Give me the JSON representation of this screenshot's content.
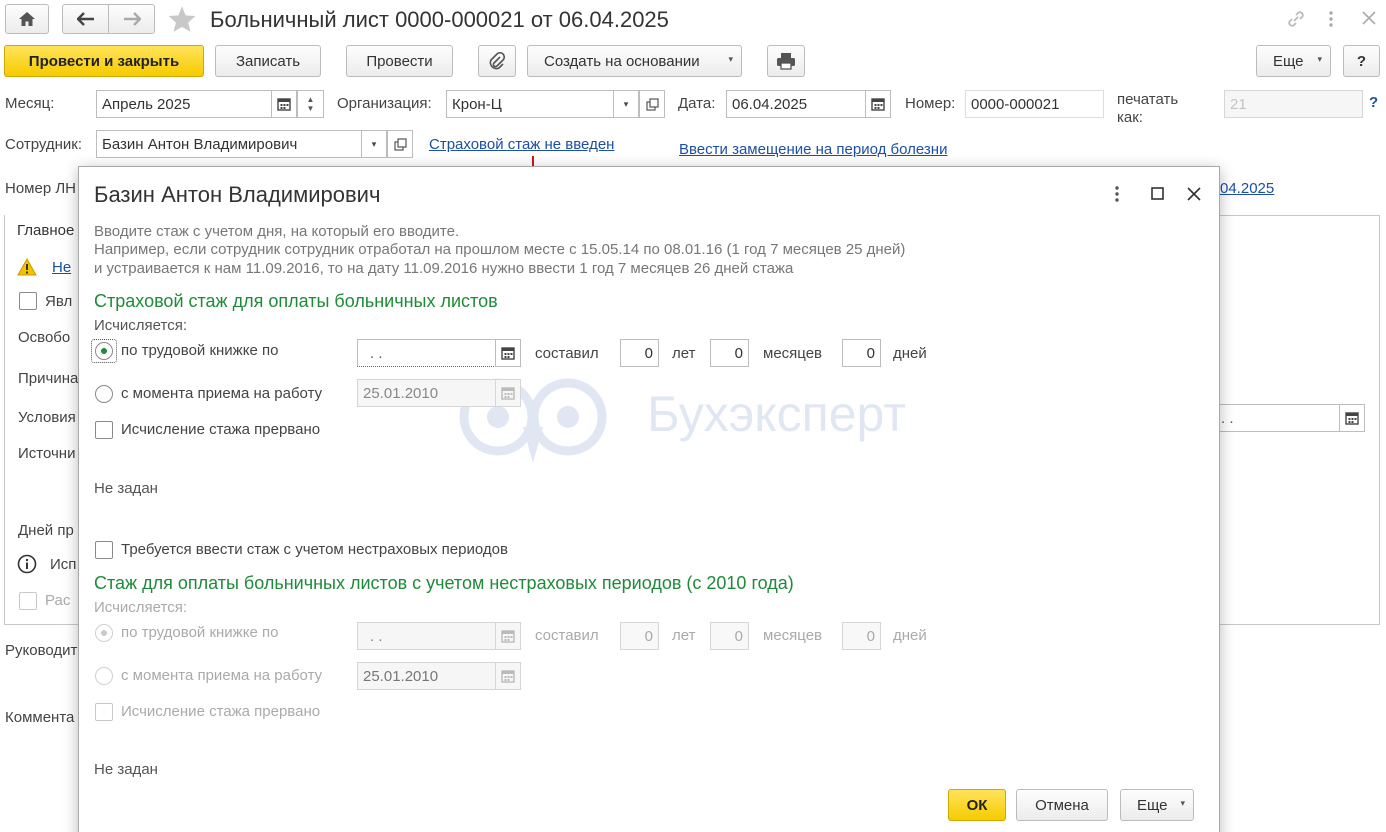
{
  "window": {
    "title": "Больничный лист 0000-000021 от 06.04.2025"
  },
  "toolbar": {
    "post_close": "Провести и закрыть",
    "save": "Записать",
    "post": "Провести",
    "create_based": "Создать на основании",
    "more": "Еще",
    "help": "?"
  },
  "form": {
    "month_label": "Месяц:",
    "month_value": "Апрель 2025",
    "org_label": "Организация:",
    "org_value": "Крон-Ц",
    "date_label": "Дата:",
    "date_value": "06.04.2025",
    "number_label": "Номер:",
    "number_value": "0000-000021",
    "print_as_label": "печатать как:",
    "print_as_placeholder": "21",
    "print_as_help": "?",
    "employee_label": "Сотрудник:",
    "employee_value": "Базин Антон Владимирович",
    "insurance_link": "Страховой стаж не введен",
    "replacement_link": "Ввести замещение на период болезни",
    "lnr_label": "Номер ЛН",
    "right_date_link": "04.2025",
    "tab_main": "Главное",
    "warn_link": "Не",
    "row_is": "Явл",
    "row_release": "Освобо",
    "row_reason": "Причина",
    "row_conditions": "Условия",
    "row_source": "Источни",
    "row_days": "Дней пр",
    "row_use": "Исп",
    "row_calc": "Рас",
    "right_date_field": ".   .",
    "head_label": "Руководит",
    "comment_label": "Коммента"
  },
  "dialog": {
    "title": "Базин Антон Владимирович",
    "hint_lines": [
      "Вводите стаж с учетом дня, на который его вводите.",
      "Например, если сотрудник сотрудник отработал на прошлом месте с 15.05.14 по 08.01.16 (1 год 7 месяцев 25 дней)",
      "и устраивается к нам 11.09.2016, то на дату 11.09.2016 нужно ввести 1 год 7 месяцев 26 дней стажа"
    ],
    "section1": {
      "title": "Страховой стаж для оплаты больничных листов",
      "computed_label": "Исчисляется:",
      "opt_book": "по трудовой книжке по",
      "book_date": ".   .",
      "made_label": "составил",
      "years": "0",
      "years_label": "лет",
      "months": "0",
      "months_label": "месяцев",
      "days": "0",
      "days_label": "дней",
      "opt_hire": "с момента приема на работу",
      "hire_date": "25.01.2010",
      "interrupted": "Исчисление стажа прервано",
      "not_set": "Не задан"
    },
    "noninsurance_check": "Требуется ввести стаж с учетом нестраховых периодов",
    "section2": {
      "title": "Стаж для оплаты больничных листов с учетом нестраховых периодов (с 2010 года)",
      "computed_label": "Исчисляется:",
      "opt_book": "по трудовой книжке по",
      "book_date": ".   .",
      "made_label": "составил",
      "years": "0",
      "years_label": "лет",
      "months": "0",
      "months_label": "месяцев",
      "days": "0",
      "days_label": "дней",
      "opt_hire": "с момента приема на работу",
      "hire_date": "25.01.2010",
      "interrupted": "Исчисление стажа прервано",
      "not_set": "Не задан"
    },
    "ok": "ОК",
    "cancel": "Отмена",
    "more": "Еще"
  },
  "watermark": "Бухэксперт",
  "icons": [
    "home-icon",
    "back-arrow-icon",
    "forward-arrow-icon",
    "star-icon",
    "link-icon",
    "kebab-icon",
    "close-icon",
    "paperclip-icon",
    "printer-icon",
    "calendar-icon",
    "dropdown-icon",
    "open-icon",
    "warning-icon",
    "info-icon",
    "maximize-icon"
  ],
  "colors": {
    "accent_yellow": "#f6cb00",
    "link": "#1c4fa5",
    "green_heading": "#1f8a39",
    "red_arrow": "#d0141b"
  }
}
